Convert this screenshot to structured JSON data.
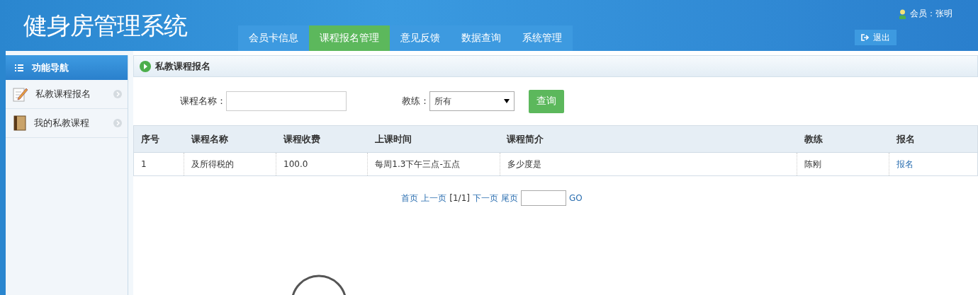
{
  "header": {
    "title": "健身房管理系统",
    "user": "会员：张明",
    "logout": "退出"
  },
  "nav_tabs": [
    {
      "label": "会员卡信息",
      "selected": false
    },
    {
      "label": "课程报名管理",
      "selected": true
    },
    {
      "label": "意见反馈",
      "selected": false
    },
    {
      "label": "数据查询",
      "selected": false
    },
    {
      "label": "系统管理",
      "selected": false
    }
  ],
  "sidebar": {
    "title": "功能导航",
    "items": [
      {
        "label": "私教课程报名",
        "kind": "pencil"
      },
      {
        "label": "我的私教课程",
        "kind": "book"
      }
    ]
  },
  "panel": {
    "title": "私教课程报名"
  },
  "search": {
    "name_label": "课程名称：",
    "coach_label": "教练：",
    "coach_value": "所有",
    "button": "查询"
  },
  "table": {
    "columns": [
      "序号",
      "课程名称",
      "课程收费",
      "上课时间",
      "课程简介",
      "教练",
      "报名"
    ],
    "rows": [
      {
        "cells": [
          "1",
          "及所得税的",
          "100.0",
          "每周1.3下午三点-五点",
          "多少度是",
          "陈刚"
        ],
        "action": "报名"
      }
    ]
  },
  "pagination": {
    "first": "首页",
    "prev": "上一页",
    "status": "[1/1]",
    "next": "下一页",
    "last": "尾页",
    "go": "GO"
  }
}
